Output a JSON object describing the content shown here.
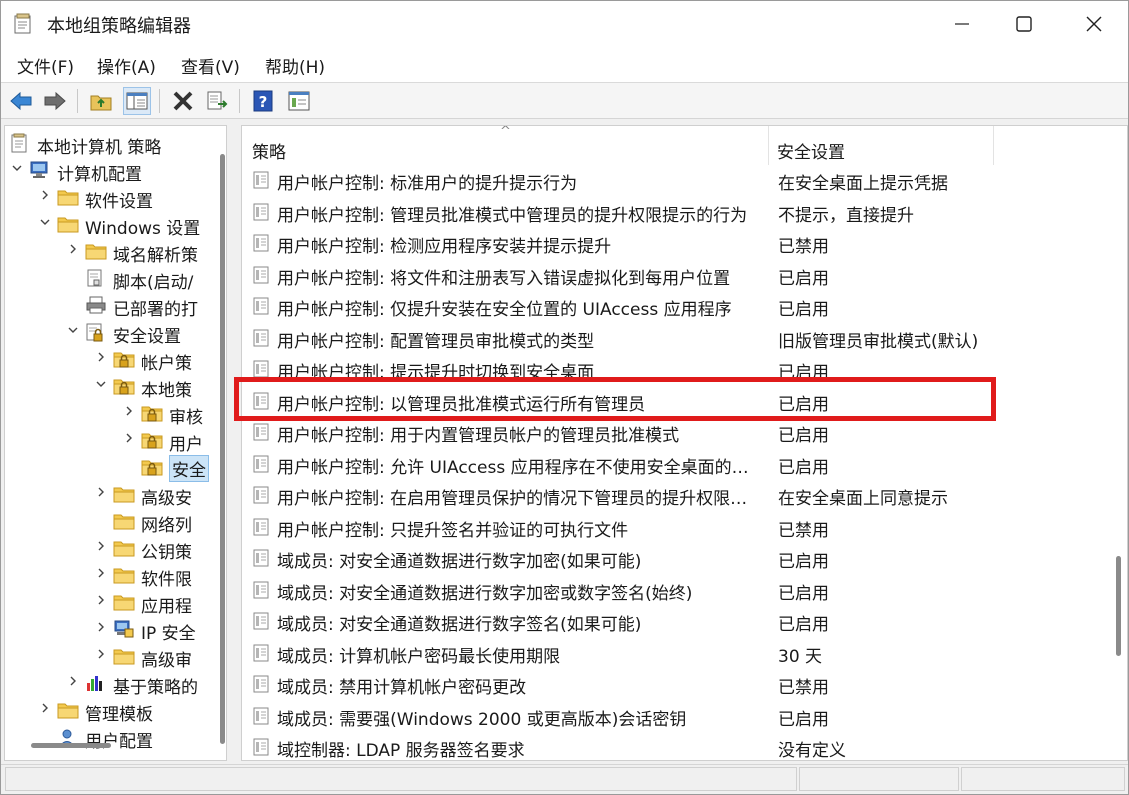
{
  "window": {
    "title": "本地组策略编辑器"
  },
  "menu": {
    "items": [
      "文件(F)",
      "操作(A)",
      "查看(V)",
      "帮助(H)"
    ]
  },
  "toolbar": {
    "buttons": [
      "back-icon",
      "forward-icon",
      "up-folder-icon",
      "show-hide-tree-icon",
      "delete-icon",
      "export-list-icon",
      "help-icon",
      "properties-icon"
    ]
  },
  "tree": {
    "items": [
      {
        "label": "本地计算机 策略",
        "icon": "computer-policy-icon",
        "expander": ""
      },
      {
        "label": "计算机配置",
        "icon": "computer-icon",
        "expander": "open"
      },
      {
        "label": "软件设置",
        "icon": "folder-icon",
        "expander": "closed"
      },
      {
        "label": "Windows 设置",
        "icon": "folder-icon",
        "expander": "open"
      },
      {
        "label": "域名解析策",
        "icon": "folder-icon",
        "expander": "closed"
      },
      {
        "label": "脚本(启动/",
        "icon": "script-icon",
        "expander": ""
      },
      {
        "label": "已部署的打",
        "icon": "printer-icon",
        "expander": ""
      },
      {
        "label": "安全设置",
        "icon": "security-settings-icon",
        "expander": "open"
      },
      {
        "label": "帐户策",
        "icon": "locked-folder-icon",
        "expander": "closed"
      },
      {
        "label": "本地策",
        "icon": "locked-folder-icon",
        "expander": "open"
      },
      {
        "label": "审核",
        "icon": "locked-folder-icon",
        "expander": "closed"
      },
      {
        "label": "用户",
        "icon": "locked-folder-icon",
        "expander": "closed"
      },
      {
        "label": "安全",
        "icon": "locked-folder-icon",
        "expander": ""
      },
      {
        "label": "高级安",
        "icon": "folder-icon",
        "expander": "closed"
      },
      {
        "label": "网络列",
        "icon": "folder-icon",
        "expander": ""
      },
      {
        "label": "公钥策",
        "icon": "folder-icon",
        "expander": "closed"
      },
      {
        "label": "软件限",
        "icon": "folder-icon",
        "expander": "closed"
      },
      {
        "label": "应用程",
        "icon": "folder-icon",
        "expander": "closed"
      },
      {
        "label": "IP 安全",
        "icon": "ip-security-icon",
        "expander": "closed"
      },
      {
        "label": "高级审",
        "icon": "folder-icon",
        "expander": "closed"
      },
      {
        "label": "基于策略的",
        "icon": "chart-icon",
        "expander": "closed"
      },
      {
        "label": "管理模板",
        "icon": "folder-icon",
        "expander": "closed"
      },
      {
        "label": "用户配置",
        "icon": "user-icon",
        "expander": ""
      }
    ]
  },
  "list": {
    "columns": {
      "policy": "策略",
      "setting": "安全设置"
    },
    "rows": [
      {
        "name": "用户帐户控制: 标准用户的提升提示行为",
        "value": "在安全桌面上提示凭据"
      },
      {
        "name": "用户帐户控制: 管理员批准模式中管理员的提升权限提示的行为",
        "value": "不提示，直接提升"
      },
      {
        "name": "用户帐户控制: 检测应用程序安装并提示提升",
        "value": "已禁用"
      },
      {
        "name": "用户帐户控制: 将文件和注册表写入错误虚拟化到每用户位置",
        "value": "已启用"
      },
      {
        "name": "用户帐户控制: 仅提升安装在安全位置的 UIAccess 应用程序",
        "value": "已启用"
      },
      {
        "name": "用户帐户控制: 配置管理员审批模式的类型",
        "value": "旧版管理员审批模式(默认)"
      },
      {
        "name": "用户帐户控制: 提示提升时切换到安全桌面",
        "value": "已启用"
      },
      {
        "name": "用户帐户控制: 以管理员批准模式运行所有管理员",
        "value": "已启用"
      },
      {
        "name": "用户帐户控制: 用于内置管理员帐户的管理员批准模式",
        "value": "已启用"
      },
      {
        "name": "用户帐户控制: 允许 UIAccess 应用程序在不使用安全桌面的情况下提升",
        "value": "已启用"
      },
      {
        "name": "用户帐户控制: 在启用管理员保护的情况下管理员的提升权限提示的行为",
        "value": "在安全桌面上同意提示"
      },
      {
        "name": "用户帐户控制: 只提升签名并验证的可执行文件",
        "value": "已禁用"
      },
      {
        "name": "域成员: 对安全通道数据进行数字加密(如果可能)",
        "value": "已启用"
      },
      {
        "name": "域成员: 对安全通道数据进行数字加密或数字签名(始终)",
        "value": "已启用"
      },
      {
        "name": "域成员: 对安全通道数据进行数字签名(如果可能)",
        "value": "已启用"
      },
      {
        "name": "域成员: 计算机帐户密码最长使用期限",
        "value": "30 天"
      },
      {
        "name": "域成员: 禁用计算机帐户密码更改",
        "value": "已禁用"
      },
      {
        "name": "域成员: 需要强(Windows 2000 或更高版本)会话密钥",
        "value": "已启用"
      },
      {
        "name": "域控制器: LDAP 服务器签名要求",
        "value": "没有定义"
      }
    ]
  },
  "colors": {
    "highlight": "#e01b1b",
    "selection": "#cce4f7"
  }
}
